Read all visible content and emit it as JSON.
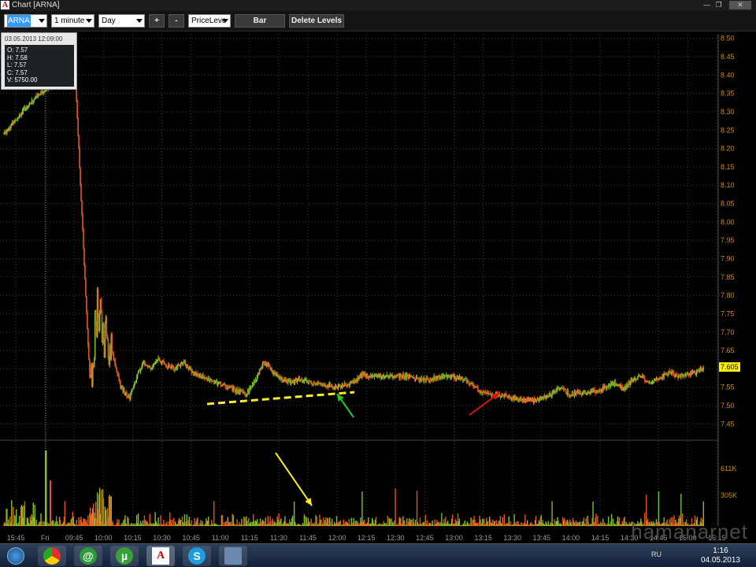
{
  "window": {
    "title": "Chart [ARNA]",
    "app_glyph": "A"
  },
  "toolbar": {
    "symbol": "ARNA",
    "interval": "1 minute",
    "range": "Day",
    "zoom_in": "+",
    "zoom_out": "-",
    "indicator": "PriceLeve",
    "chart_type_button": "Bar",
    "delete_levels_button": "Delete Levels"
  },
  "ohlc_tooltip": {
    "timestamp": "03.05.2013 12:09:00",
    "open": "O: 7.57",
    "high": "H: 7.58",
    "low": "L: 7.57",
    "close": "C: 7.57",
    "volume": "V: 5750.00"
  },
  "chart_data": {
    "type": "candlestick",
    "x_tick_labels": [
      "15:45",
      "Fri",
      "09:45",
      "10:00",
      "10:15",
      "10:30",
      "10:45",
      "11:00",
      "11:15",
      "11:30",
      "11:45",
      "12:00",
      "12:15",
      "12:30",
      "12:45",
      "13:00",
      "13:15",
      "13:30",
      "13:45",
      "14:00",
      "14:15",
      "14:30",
      "14:45",
      "15:00",
      "15:15"
    ],
    "price_axis_ticks": [
      "8.50",
      "8.45",
      "8.40",
      "8.35",
      "8.30",
      "8.25",
      "8.20",
      "8.15",
      "8.10",
      "8.05",
      "8.00",
      "7.95",
      "7.90",
      "7.85",
      "7.80",
      "7.75",
      "7.70",
      "7.65",
      "7.60",
      "7.55",
      "7.50",
      "7.45"
    ],
    "price_range": [
      7.41,
      8.51
    ],
    "last_price": "7.605",
    "volume_axis_ticks": [
      "611K",
      "305K"
    ],
    "price_path": [
      [
        0,
        8.24
      ],
      [
        1,
        8.3
      ],
      [
        2,
        8.35
      ],
      [
        3,
        8.38
      ],
      [
        4,
        8.37
      ],
      [
        4.8,
        7.55
      ],
      [
        5.2,
        7.75
      ],
      [
        5.6,
        7.68
      ],
      [
        6,
        7.65
      ],
      [
        6.5,
        7.55
      ],
      [
        7,
        7.52
      ],
      [
        7.4,
        7.58
      ],
      [
        7.8,
        7.62
      ],
      [
        8.2,
        7.6
      ],
      [
        8.6,
        7.63
      ],
      [
        9,
        7.61
      ],
      [
        9.5,
        7.6
      ],
      [
        10,
        7.62
      ],
      [
        10.5,
        7.59
      ],
      [
        11,
        7.58
      ],
      [
        11.5,
        7.57
      ],
      [
        12,
        7.56
      ],
      [
        12.5,
        7.55
      ],
      [
        13,
        7.54
      ],
      [
        13.5,
        7.53
      ],
      [
        14,
        7.57
      ],
      [
        14.5,
        7.62
      ],
      [
        15,
        7.59
      ],
      [
        15.5,
        7.57
      ],
      [
        16,
        7.565
      ],
      [
        16.5,
        7.57
      ],
      [
        17,
        7.565
      ],
      [
        17.5,
        7.56
      ],
      [
        18,
        7.555
      ],
      [
        18.5,
        7.55
      ],
      [
        19,
        7.555
      ],
      [
        19.5,
        7.565
      ],
      [
        20,
        7.585
      ],
      [
        20.5,
        7.58
      ],
      [
        21,
        7.58
      ],
      [
        21.5,
        7.58
      ],
      [
        22,
        7.58
      ],
      [
        22.5,
        7.58
      ],
      [
        23,
        7.575
      ],
      [
        23.5,
        7.57
      ],
      [
        24,
        7.575
      ],
      [
        24.5,
        7.58
      ],
      [
        25,
        7.578
      ],
      [
        25.5,
        7.575
      ],
      [
        26,
        7.56
      ],
      [
        26.5,
        7.54
      ],
      [
        27,
        7.53
      ],
      [
        27.5,
        7.53
      ],
      [
        28,
        7.525
      ],
      [
        28.5,
        7.52
      ],
      [
        29,
        7.515
      ],
      [
        29.5,
        7.515
      ],
      [
        30,
        7.52
      ],
      [
        30.5,
        7.53
      ],
      [
        31,
        7.55
      ],
      [
        31.5,
        7.53
      ],
      [
        32,
        7.535
      ],
      [
        32.5,
        7.535
      ],
      [
        33,
        7.54
      ],
      [
        33.5,
        7.55
      ],
      [
        34,
        7.56
      ],
      [
        34.5,
        7.545
      ],
      [
        35,
        7.57
      ],
      [
        35.5,
        7.58
      ],
      [
        36,
        7.56
      ],
      [
        36.5,
        7.575
      ],
      [
        37,
        7.59
      ],
      [
        37.5,
        7.58
      ],
      [
        38,
        7.585
      ],
      [
        38.5,
        7.59
      ],
      [
        39,
        7.605
      ]
    ],
    "annotations": [
      {
        "type": "dashed-trendline",
        "color": "#ffee22"
      },
      {
        "type": "arrow",
        "color": "#22cc22"
      },
      {
        "type": "arrow",
        "color": "#dd1111"
      },
      {
        "type": "arrow",
        "color": "#ffee22"
      }
    ]
  },
  "taskbar": {
    "apps": [
      {
        "name": "start-button"
      },
      {
        "name": "chrome"
      },
      {
        "name": "email",
        "glyph": "@"
      },
      {
        "name": "utorrent",
        "glyph": "µ"
      },
      {
        "name": "trading-app",
        "glyph": "A"
      },
      {
        "name": "skype",
        "glyph": "S"
      },
      {
        "name": "explorer"
      }
    ],
    "lang": "RU",
    "time": "1:16",
    "date": "04.05.2013"
  },
  "watermark": "hamanarnet",
  "colors": {
    "up": "#7fc12a",
    "down": "#e05a1e",
    "axis_text": "#c88a1e",
    "grid": "#3c3c3c"
  }
}
